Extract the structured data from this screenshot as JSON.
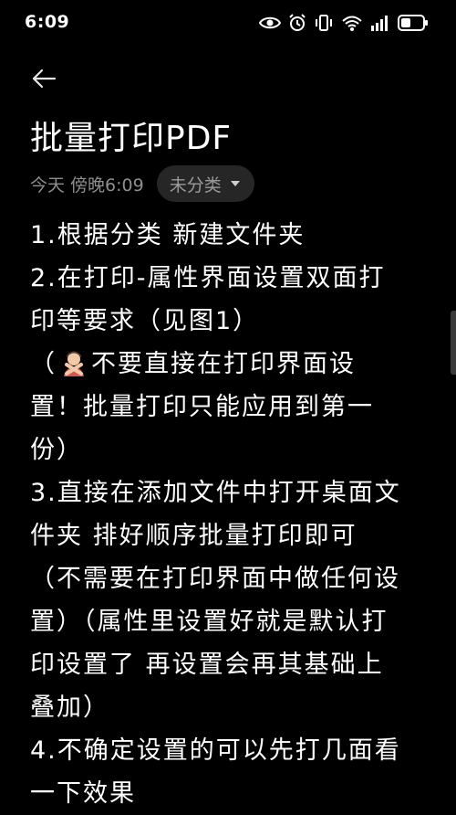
{
  "status_bar": {
    "time": "6:09",
    "icons": [
      "eye-icon",
      "alarm-icon",
      "vibrate-icon",
      "wifi-6-icon",
      "signal-icon",
      "battery-icon"
    ]
  },
  "header": {
    "back_icon": "arrow-left-icon"
  },
  "note": {
    "title": "批量打印PDF",
    "date": "今天 傍晚6:09",
    "category": "未分类",
    "lines": [
      "1.根据分类 新建文件夹",
      "2.在打印-属性界面设置双面打",
      "印等要求（见图1）",
      "不要直接在打印界面设",
      "置！批量打印只能应用到第一",
      "份）",
      "3.直接在添加文件中打开桌面文",
      "件夹 排好顺序批量打印即可",
      "（不需要在打印界面中做任何设",
      "置）（属性里设置好就是默认打",
      "印设置了 再设置会再其基础上",
      "叠加）",
      "4.不确定设置的可以先打几面看",
      "一下效果"
    ],
    "line4_prefix": "（"
  },
  "colors": {
    "background": "#000000",
    "text": "#ffffff",
    "meta_text": "#8e8e8e",
    "chip_bg": "#262626"
  }
}
